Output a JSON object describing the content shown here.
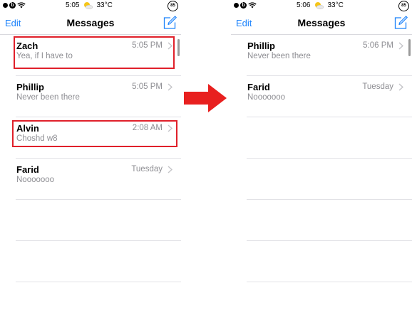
{
  "before": {
    "status": {
      "time": "5:05",
      "temperature": "33°C",
      "battery": "85"
    },
    "nav": {
      "edit_label": "Edit",
      "title": "Messages"
    },
    "conversations": [
      {
        "name": "Zach",
        "preview": "Yea, if I have to",
        "time": "5:05 PM",
        "highlighted": true
      },
      {
        "name": "Phillip",
        "preview": "Never been there",
        "time": "5:05 PM",
        "highlighted": false
      },
      {
        "name": "Alvin",
        "preview": "Choshd w8",
        "time": "2:08 AM",
        "highlighted": true
      },
      {
        "name": "Farid",
        "preview": "Nooooooo",
        "time": "Tuesday",
        "highlighted": false
      }
    ]
  },
  "after": {
    "status": {
      "time": "5:06",
      "temperature": "33°C",
      "battery": "85"
    },
    "nav": {
      "edit_label": "Edit",
      "title": "Messages"
    },
    "conversations": [
      {
        "name": "Phillip",
        "preview": "Never been there",
        "time": "5:06 PM"
      },
      {
        "name": "Farid",
        "preview": "Nooooooo",
        "time": "Tuesday"
      }
    ]
  },
  "colors": {
    "accent": "#1b82fb",
    "highlight": "#e0202a",
    "arrow": "#e8201f",
    "secondary_text": "#8e8e93"
  },
  "icons": {
    "compose": "compose-icon",
    "chevron": "chevron-right-icon",
    "weather": "weather-sun-cloud-icon",
    "arrow": "right-arrow-icon"
  }
}
